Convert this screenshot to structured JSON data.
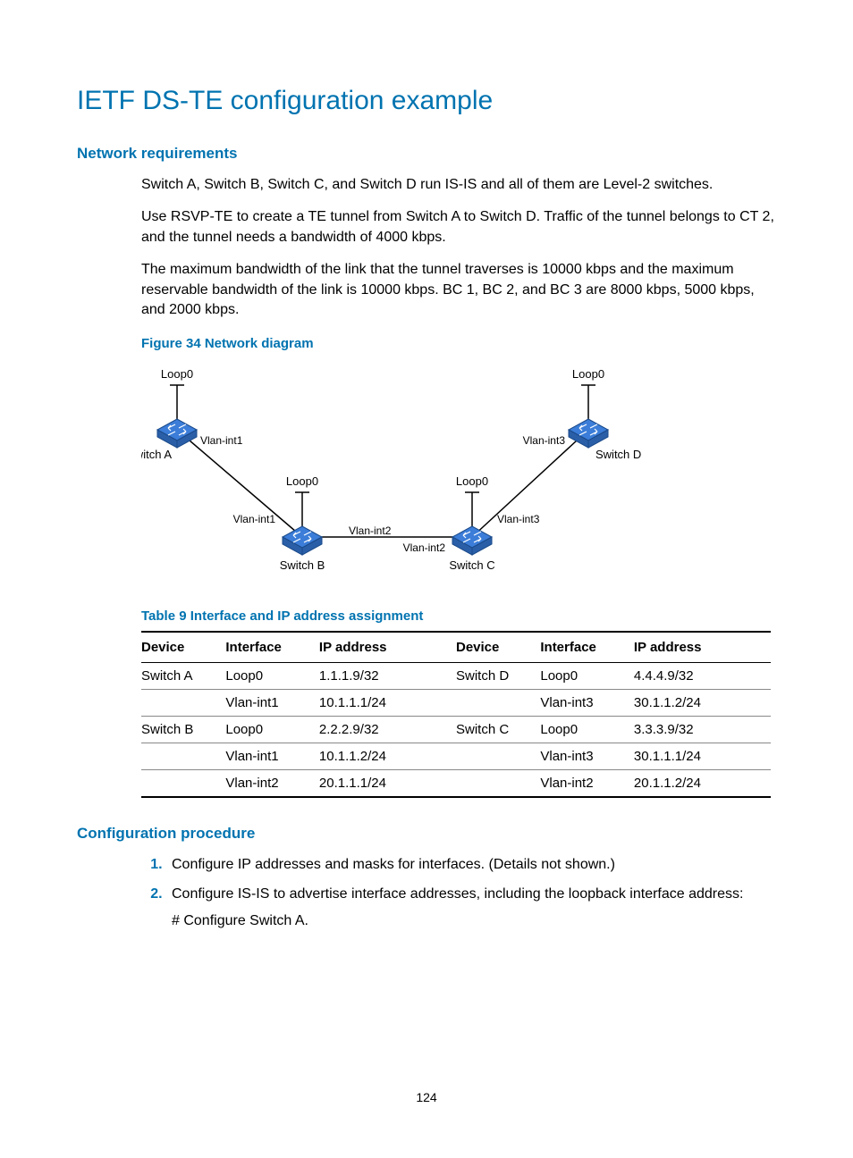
{
  "title": "IETF DS-TE configuration example",
  "section_req": "Network requirements",
  "para1": "Switch A, Switch B, Switch C, and Switch D run IS-IS and all of them are Level-2 switches.",
  "para2": "Use RSVP-TE to create a TE tunnel from Switch A to Switch D. Traffic of the tunnel belongs to CT 2, and the tunnel needs a bandwidth of 4000 kbps.",
  "para3": "The maximum bandwidth of the link that the tunnel traverses is 10000 kbps and the maximum reservable bandwidth of the link is 10000 kbps. BC 1, BC 2, and BC 3 are 8000 kbps, 5000 kbps, and 2000 kbps.",
  "figure_caption": "Figure 34 Network diagram",
  "diagram": {
    "nodes": {
      "A": {
        "name": "Switch A",
        "loop": "Loop0",
        "ports": [
          "Vlan-int1"
        ]
      },
      "B": {
        "name": "Switch B",
        "loop": "Loop0",
        "ports": [
          "Vlan-int1",
          "Vlan-int2"
        ]
      },
      "C": {
        "name": "Switch C",
        "loop": "Loop0",
        "ports": [
          "Vlan-int2",
          "Vlan-int3"
        ]
      },
      "D": {
        "name": "Switch D",
        "loop": "Loop0",
        "ports": [
          "Vlan-int3"
        ]
      }
    }
  },
  "table_caption": "Table 9 Interface and IP address assignment",
  "table": {
    "headers": [
      "Device",
      "Interface",
      "IP address",
      "Device",
      "Interface",
      "IP address"
    ],
    "rows": [
      [
        "Switch A",
        "Loop0",
        "1.1.1.9/32",
        "Switch D",
        "Loop0",
        "4.4.4.9/32"
      ],
      [
        "",
        "Vlan-int1",
        "10.1.1.1/24",
        "",
        "Vlan-int3",
        "30.1.1.2/24"
      ],
      [
        "Switch B",
        "Loop0",
        "2.2.2.9/32",
        "Switch C",
        "Loop0",
        "3.3.3.9/32"
      ],
      [
        "",
        "Vlan-int1",
        "10.1.1.2/24",
        "",
        "Vlan-int3",
        "30.1.1.1/24"
      ],
      [
        "",
        "Vlan-int2",
        "20.1.1.1/24",
        "",
        "Vlan-int2",
        "20.1.1.2/24"
      ]
    ]
  },
  "section_proc": "Configuration procedure",
  "steps": [
    {
      "text": "Configure IP addresses and masks for interfaces. (Details not shown.)",
      "sub": null
    },
    {
      "text": "Configure IS-IS to advertise interface addresses, including the loopback interface address:",
      "sub": "# Configure Switch A."
    }
  ],
  "page_number": "124"
}
